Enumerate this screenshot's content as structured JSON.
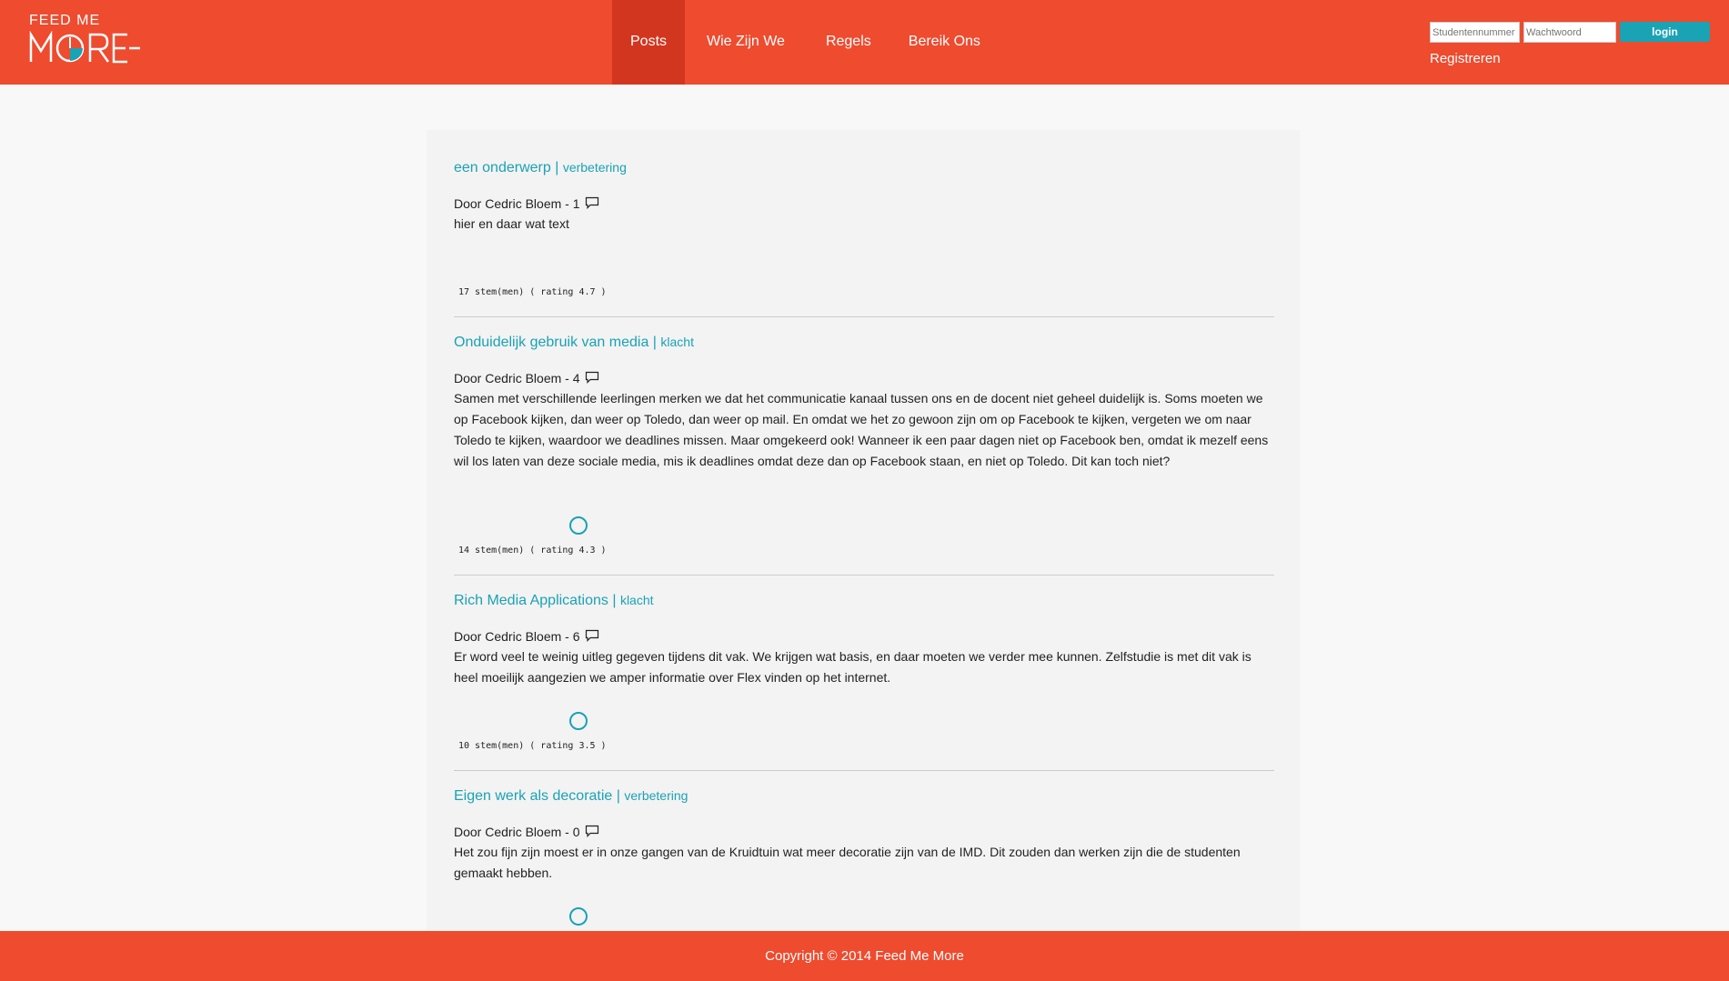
{
  "brand": {
    "top": "FEED ME",
    "bottom_left": "M",
    "bottom_right": "RE"
  },
  "nav": {
    "items": [
      {
        "label": "Posts",
        "active": true
      },
      {
        "label": "Wie Zijn We",
        "active": false
      },
      {
        "label": "Regels",
        "active": false
      },
      {
        "label": "Bereik Ons",
        "active": false
      }
    ]
  },
  "login": {
    "user_placeholder": "Studentennummer",
    "pass_placeholder": "Wachtwoord",
    "button": "login",
    "register": "Registreren"
  },
  "posts": [
    {
      "title": "een onderwerp",
      "separator": "|",
      "category": "verbetering",
      "author": "Door Cedric Bloem - 1",
      "body": "hier en daar wat text",
      "votes": "17 stem(men) ( rating 4.7 )"
    },
    {
      "title": "Onduidelijk gebruik van media",
      "separator": "|",
      "category": "klacht",
      "author": "Door Cedric Bloem - 4",
      "body": "Samen met verschillende leerlingen merken we dat het communicatie kanaal tussen ons en de docent niet geheel duidelijk is. Soms moeten we op Facebook kijken, dan weer op Toledo, dan weer op mail. En omdat we het zo gewoon zijn om op Facebook te kijken, vergeten we om naar Toledo te kijken, waardoor we deadlines missen. Maar omgekeerd ook! Wanneer ik een paar dagen niet op Facebook ben, omdat ik mezelf eens wil los laten van deze sociale media, mis ik deadlines omdat deze dan op Facebook staan, en niet op Toledo. Dit kan toch niet?",
      "votes": "14 stem(men) ( rating 4.3 )"
    },
    {
      "title": "Rich Media Applications",
      "separator": "|",
      "category": "klacht",
      "author": "Door Cedric Bloem - 6",
      "body": "Er word veel te weinig uitleg gegeven tijdens dit vak. We krijgen wat basis, en daar moeten we verder mee kunnen. Zelfstudie is met dit vak is heel moeilijk aangezien we amper informatie over Flex vinden op het internet.",
      "votes": "10 stem(men) ( rating 3.5 )"
    },
    {
      "title": "Eigen werk als decoratie",
      "separator": "|",
      "category": "verbetering",
      "author": "Door Cedric Bloem - 0",
      "body": "Het zou fijn zijn moest er in onze gangen van de Kruidtuin wat meer decoratie zijn van de IMD. Dit zouden dan werken zijn die de studenten gemaakt hebben.",
      "votes": ""
    }
  ],
  "footer": {
    "text": "Copyright © 2014 Feed Me More"
  },
  "colors": {
    "accent": "#ee4b2f",
    "accent_dark": "#d3361f",
    "link": "#1aa2b5"
  }
}
